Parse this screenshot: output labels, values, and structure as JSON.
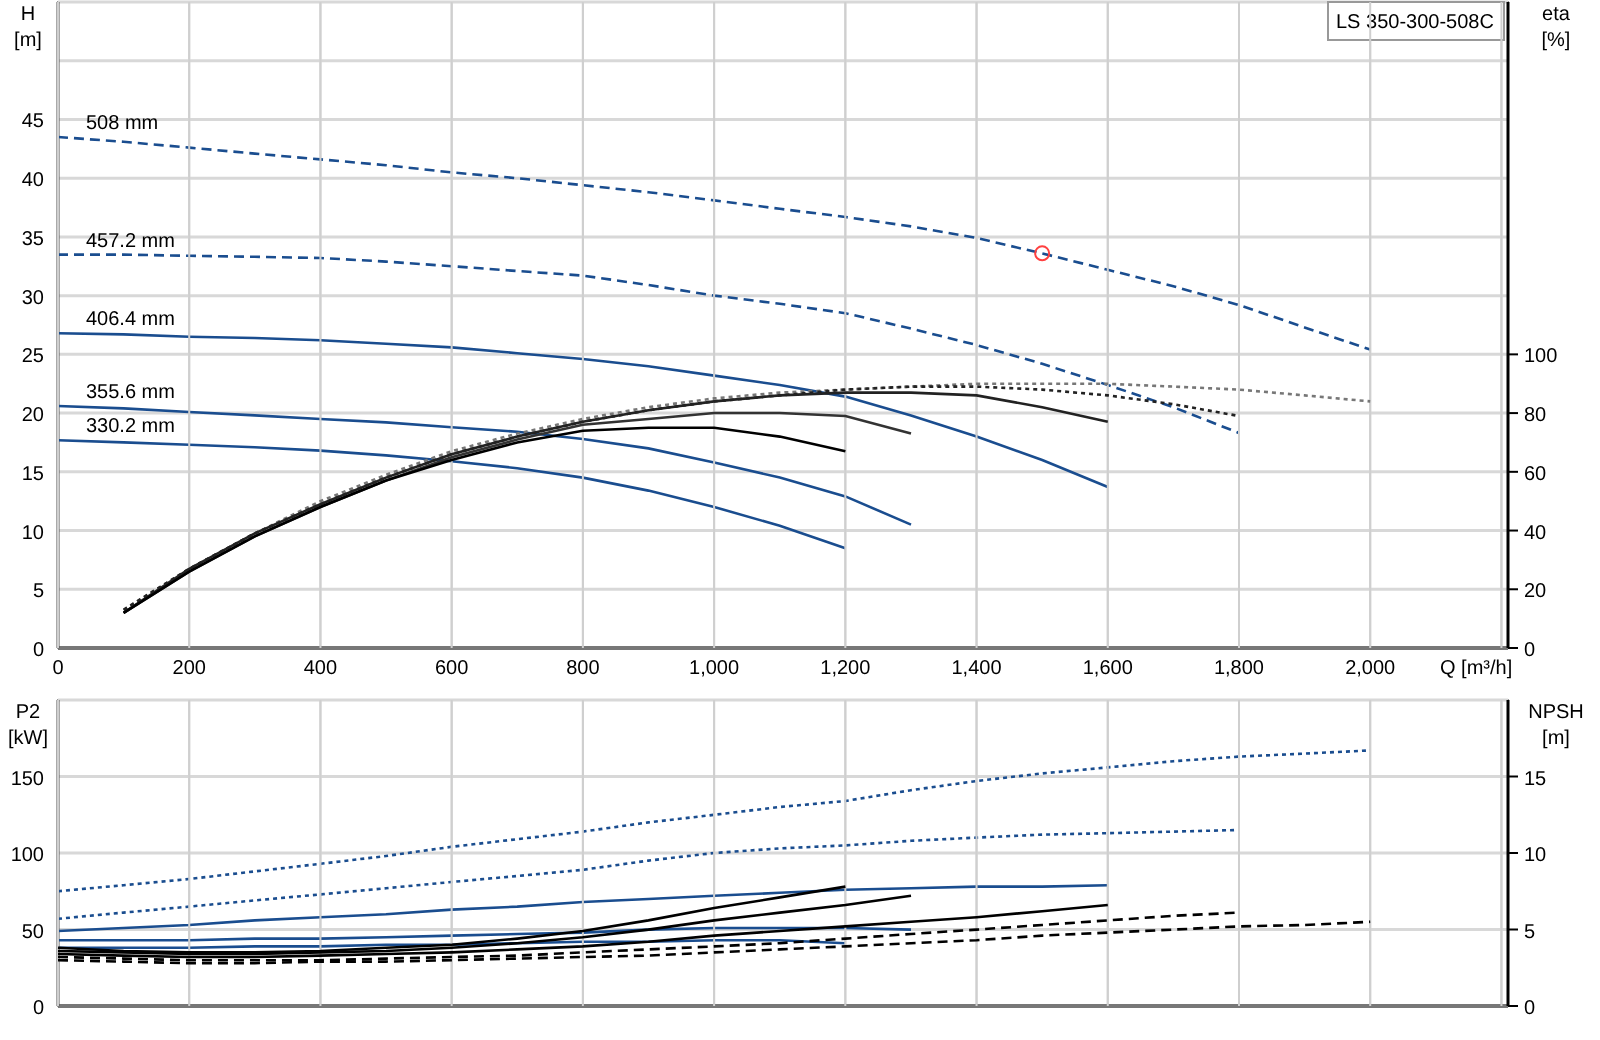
{
  "head_chart": {
    "chart_data": {
      "type": "line",
      "title": "LS 350-300-508C",
      "xlabel": "Q [m³/h]",
      "ylabel": "H [m]",
      "grid": true,
      "xlim": [
        0,
        2210
      ],
      "ylim": [
        0,
        55
      ],
      "xticks": [
        0,
        200,
        400,
        600,
        800,
        {
          "value": 1000,
          "label": "1,000"
        },
        {
          "value": 1200,
          "label": "1,200"
        },
        {
          "value": 1400,
          "label": "1,400"
        },
        {
          "value": 1600,
          "label": "1,600"
        },
        {
          "value": 1800,
          "label": "1,800"
        },
        {
          "value": 2000,
          "label": "2,000"
        }
      ],
      "yticks": [
        0,
        5,
        10,
        15,
        20,
        25,
        30,
        35,
        40,
        45
      ],
      "x": [
        0,
        100,
        200,
        300,
        400,
        500,
        600,
        700,
        800,
        900,
        1000,
        1100,
        1200,
        1300,
        1400,
        1500,
        1600,
        1700,
        1800,
        1900,
        2000
      ],
      "series": [
        {
          "name": "508 mm",
          "color": "#1a4d8f",
          "line_style": "dashed",
          "values": [
            43.5,
            43.1,
            42.6,
            42.1,
            41.6,
            41.1,
            40.5,
            40.0,
            39.4,
            38.8,
            38.1,
            37.4,
            36.7,
            35.9,
            34.9,
            33.6,
            32.2,
            30.8,
            29.2,
            27.3,
            25.4
          ]
        },
        {
          "name": "457.2 mm",
          "color": "#1a4d8f",
          "line_style": "dashed",
          "values": [
            33.5,
            33.5,
            33.4,
            33.3,
            33.2,
            32.9,
            32.5,
            32.1,
            31.7,
            30.9,
            30.0,
            29.3,
            28.5,
            27.2,
            25.8,
            24.2,
            22.4,
            20.5,
            18.3,
            null,
            null
          ]
        },
        {
          "name": "406.4 mm",
          "color": "#1a4d8f",
          "line_style": "solid",
          "values": [
            26.8,
            26.7,
            26.5,
            26.4,
            26.2,
            25.9,
            25.6,
            25.1,
            24.6,
            24.0,
            23.2,
            22.4,
            21.4,
            19.8,
            18.0,
            16.0,
            13.7,
            null,
            null,
            null,
            null
          ]
        },
        {
          "name": "355.6 mm",
          "color": "#1a4d8f",
          "line_style": "solid",
          "values": [
            20.6,
            20.4,
            20.1,
            19.8,
            19.5,
            19.2,
            18.8,
            18.4,
            17.8,
            17.0,
            15.8,
            14.5,
            12.9,
            10.5,
            null,
            null,
            null,
            null,
            null,
            null,
            null
          ]
        },
        {
          "name": "330.2 mm",
          "color": "#1a4d8f",
          "line_style": "solid",
          "values": [
            17.7,
            17.5,
            17.3,
            17.1,
            16.8,
            16.4,
            15.9,
            15.3,
            14.5,
            13.4,
            12.0,
            10.4,
            8.5,
            null,
            null,
            null,
            null,
            null,
            null,
            null,
            null
          ]
        },
        {
          "color": "#ff4040",
          "marker": "circle",
          "values": [
            null,
            null,
            null,
            null,
            null,
            null,
            null,
            null,
            null,
            null,
            null,
            null,
            null,
            null,
            null,
            33.6,
            null,
            null,
            null,
            null,
            null
          ]
        }
      ]
    }
  },
  "efficiency_chart": {
    "chart_data": {
      "type": "line",
      "ylabel": "eta [%]",
      "grid": true,
      "xlim": [
        0,
        2210
      ],
      "ylim": [
        0,
        220
      ],
      "yticks": [
        0,
        20,
        40,
        60,
        80,
        100
      ],
      "x": [
        100,
        200,
        300,
        400,
        500,
        600,
        700,
        800,
        900,
        1000,
        1100,
        1200,
        1300,
        1400,
        1500,
        1600,
        1700,
        1800,
        1900,
        2000
      ],
      "series": [
        {
          "color": "#777777",
          "line_style": "dotted",
          "values": [
            13,
            27,
            39,
            50,
            59,
            67,
            73,
            78,
            82,
            85,
            87,
            88,
            89,
            90,
            90,
            90,
            89,
            88,
            86,
            84
          ]
        },
        {
          "color": "#222222",
          "line_style": "dotted",
          "values": [
            13,
            27,
            39,
            49,
            58,
            66,
            72,
            77,
            81,
            84,
            86,
            88,
            89,
            89,
            88,
            86,
            83,
            79,
            null,
            null
          ]
        },
        {
          "color": "#222222",
          "line_style": "solid",
          "values": [
            12,
            27,
            39,
            49,
            58,
            66,
            72,
            77,
            81,
            84,
            86,
            87,
            87,
            86,
            82,
            77,
            null,
            null,
            null,
            null
          ]
        },
        {
          "color": "#333333",
          "line_style": "solid",
          "values": [
            12,
            26,
            38,
            48,
            57,
            65,
            71,
            76,
            78,
            80,
            80,
            79,
            73,
            null,
            null,
            null,
            null,
            null,
            null,
            null
          ]
        },
        {
          "color": "#000000",
          "line_style": "solid",
          "values": [
            12,
            26,
            38,
            48,
            57,
            64,
            70,
            74,
            75,
            75,
            72,
            67,
            null,
            null,
            null,
            null,
            null,
            null,
            null,
            null
          ]
        }
      ]
    }
  },
  "power_chart": {
    "chart_data": {
      "type": "line",
      "ylabel": "P2 [kW]",
      "grid": true,
      "xlim": [
        0,
        2210
      ],
      "ylim": [
        0,
        200
      ],
      "yticks": [
        0,
        50,
        100,
        150
      ],
      "x": [
        0,
        100,
        200,
        300,
        400,
        500,
        600,
        700,
        800,
        900,
        1000,
        1100,
        1200,
        1300,
        1400,
        1500,
        1600,
        1700,
        1800,
        1900,
        2000
      ],
      "series": [
        {
          "color": "#1a4d8f",
          "line_style": "dotted",
          "values": [
            75,
            79,
            83,
            88,
            93,
            98,
            104,
            109,
            114,
            120,
            125,
            130,
            134,
            141,
            147,
            152,
            156,
            160,
            163,
            165,
            167
          ]
        },
        {
          "color": "#1a4d8f",
          "line_style": "dotted",
          "values": [
            57,
            61,
            65,
            69,
            73,
            77,
            81,
            85,
            89,
            95,
            100,
            103,
            105,
            108,
            110,
            112,
            113,
            114,
            115,
            null,
            null
          ]
        },
        {
          "color": "#1a4d8f",
          "line_style": "solid",
          "values": [
            49,
            51,
            53,
            56,
            58,
            60,
            63,
            65,
            68,
            70,
            72,
            74,
            76,
            77,
            78,
            78,
            79,
            null,
            null,
            null,
            null
          ]
        },
        {
          "color": "#1a4d8f",
          "line_style": "solid",
          "values": [
            43,
            43,
            43,
            44,
            44,
            45,
            46,
            47,
            48,
            50,
            51,
            51,
            51,
            50,
            null,
            null,
            null,
            null,
            null,
            null,
            null
          ]
        },
        {
          "color": "#1a4d8f",
          "line_style": "solid",
          "values": [
            38,
            38,
            38,
            39,
            39,
            40,
            40,
            41,
            42,
            42,
            43,
            43,
            41,
            null,
            null,
            null,
            null,
            null,
            null,
            null,
            null
          ]
        }
      ]
    }
  },
  "npsh_chart": {
    "chart_data": {
      "type": "line",
      "ylabel": "NPSH [m]",
      "grid": true,
      "xlim": [
        0,
        2210
      ],
      "ylim": [
        0,
        20
      ],
      "yticks": [
        0,
        5,
        10,
        15
      ],
      "x": [
        0,
        100,
        200,
        300,
        400,
        500,
        600,
        700,
        800,
        900,
        1000,
        1100,
        1200,
        1300,
        1400,
        1500,
        1600,
        1700,
        1800,
        1900,
        2000
      ],
      "series": [
        {
          "color": "#000000",
          "line_style": "dashed",
          "values": [
            3.0,
            2.9,
            2.8,
            2.8,
            2.9,
            2.9,
            3.0,
            3.1,
            3.2,
            3.3,
            3.5,
            3.7,
            3.9,
            4.1,
            4.3,
            4.6,
            4.8,
            5.0,
            5.2,
            5.3,
            5.5
          ]
        },
        {
          "color": "#000000",
          "line_style": "dashed",
          "values": [
            3.2,
            3.1,
            3.0,
            3.0,
            3.0,
            3.1,
            3.2,
            3.3,
            3.5,
            3.7,
            3.9,
            4.1,
            4.4,
            4.7,
            5.0,
            5.3,
            5.6,
            5.9,
            6.1,
            null,
            null
          ]
        },
        {
          "color": "#000000",
          "line_style": "solid",
          "values": [
            3.4,
            3.3,
            3.2,
            3.2,
            3.3,
            3.4,
            3.5,
            3.7,
            3.9,
            4.2,
            4.6,
            4.9,
            5.2,
            5.5,
            5.8,
            6.2,
            6.6,
            null,
            null,
            null,
            null
          ]
        },
        {
          "color": "#000000",
          "line_style": "solid",
          "values": [
            3.6,
            3.5,
            3.4,
            3.4,
            3.5,
            3.6,
            3.8,
            4.1,
            4.5,
            5.0,
            5.6,
            6.1,
            6.6,
            7.2,
            null,
            null,
            null,
            null,
            null,
            null,
            null
          ]
        },
        {
          "color": "#000000",
          "line_style": "solid",
          "values": [
            3.8,
            3.6,
            3.5,
            3.5,
            3.6,
            3.8,
            4.0,
            4.4,
            4.9,
            5.6,
            6.4,
            7.1,
            7.8,
            null,
            null,
            null,
            null,
            null,
            null,
            null,
            null
          ]
        }
      ]
    }
  }
}
